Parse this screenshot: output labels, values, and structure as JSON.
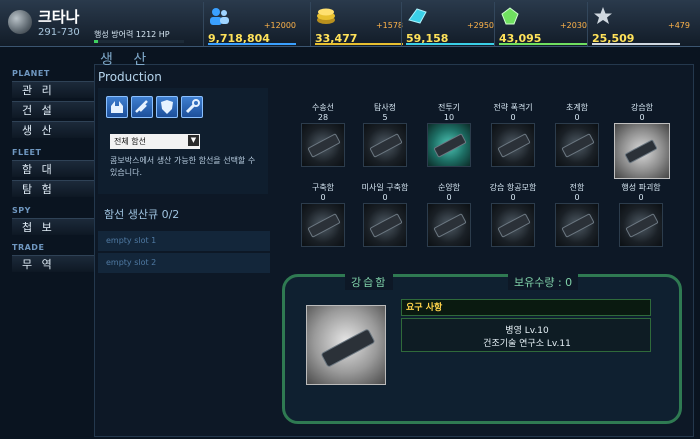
{
  "planet": {
    "name": "크타나",
    "coords": "291-730",
    "defense": "행성 방어력 1212 HP",
    "defense_fill": 0.04
  },
  "resources": [
    {
      "icon": "population-icon",
      "delta": "+12000",
      "value": "9,718,804",
      "color": "#3aa0ff"
    },
    {
      "icon": "gold-coins-icon",
      "delta": "+1578",
      "value": "33,477",
      "color": "#e8c030"
    },
    {
      "icon": "crystal-icon",
      "delta": "+2950",
      "value": "59,158",
      "color": "#3ad0e8"
    },
    {
      "icon": "green-gem-icon",
      "delta": "+2030",
      "value": "43,095",
      "color": "#70e060"
    },
    {
      "icon": "star-icon",
      "delta": "+479",
      "value": "25,509",
      "color": "#d0d8e0"
    }
  ],
  "sidebar": {
    "planet_head": "PLANET",
    "manage": "관 리",
    "build": "건 설",
    "produce": "생 산",
    "fleet_head": "FLEET",
    "fleet": "함 대",
    "explore": "탐 험",
    "spy_head": "SPY",
    "recon": "첩 보",
    "trade_head": "TRADE",
    "trade": "무 역"
  },
  "page": {
    "title_kr": "생 산",
    "title_en": "Production"
  },
  "filter": {
    "selected": "전체 함선",
    "hint": "콤보박스에서 생산 가능한 함선을 선택할 수 있습니다."
  },
  "queue": {
    "title": "함선 생산큐 0/2",
    "slots": [
      "empty slot 1",
      "empty slot 2"
    ]
  },
  "ships": [
    {
      "name": "수송선",
      "count": "28"
    },
    {
      "name": "탐사정",
      "count": "5"
    },
    {
      "name": "전투기",
      "count": "10"
    },
    {
      "name": "전략 폭격기",
      "count": "0"
    },
    {
      "name": "초계함",
      "count": "0"
    },
    {
      "name": "강습함",
      "count": "0"
    },
    {
      "name": "구축함",
      "count": "0"
    },
    {
      "name": "미사일 구축함",
      "count": "0"
    },
    {
      "name": "순양함",
      "count": "0"
    },
    {
      "name": "강습 항공모함",
      "count": "0"
    },
    {
      "name": "전함",
      "count": "0"
    },
    {
      "name": "행성 파괴함",
      "count": "0"
    }
  ],
  "detail": {
    "name": "강습함",
    "owned": "보유수량 : 0",
    "req_head": "요구 사항",
    "req1": "병영 Lv.10",
    "req2": "건조기술 연구소 Lv.11"
  }
}
